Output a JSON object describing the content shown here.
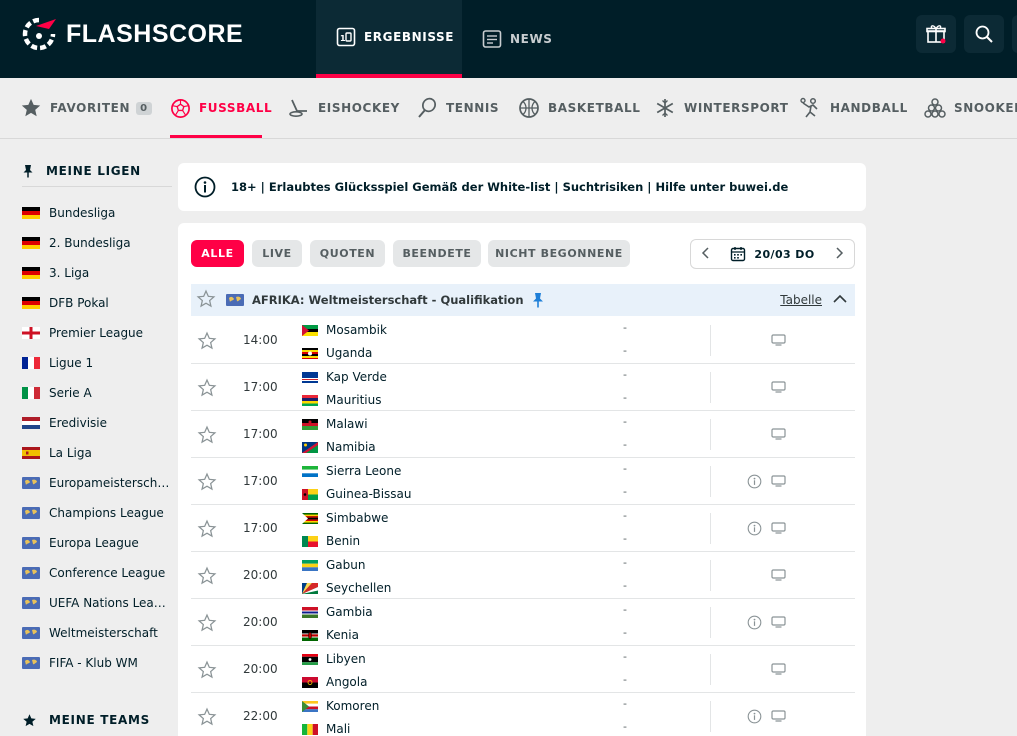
{
  "header": {
    "brand": "FLASHSCORE",
    "nav": [
      {
        "label": "ERGEBNISSE",
        "icon": "scoreboard-icon"
      },
      {
        "label": "NEWS",
        "icon": "newspaper-icon"
      }
    ],
    "actions": [
      "gift-icon",
      "search-icon"
    ]
  },
  "sports": {
    "favorites_label": "FAVORITEN",
    "favorites_count": "0",
    "items": [
      {
        "label": "FUSSBALL",
        "icon": "soccer-ball-icon",
        "active": true
      },
      {
        "label": "EISHOCKEY",
        "icon": "hockey-icon"
      },
      {
        "label": "TENNIS",
        "icon": "tennis-icon"
      },
      {
        "label": "BASKETBALL",
        "icon": "basketball-icon"
      },
      {
        "label": "WINTERSPORT",
        "icon": "snowflake-icon"
      },
      {
        "label": "HANDBALL",
        "icon": "handball-icon"
      },
      {
        "label": "SNOOKER",
        "icon": "snooker-icon"
      }
    ]
  },
  "sidebar": {
    "my_leagues_label": "MEINE LIGEN",
    "my_teams_label": "MEINE TEAMS",
    "leagues": [
      {
        "name": "Bundesliga",
        "flag": "de"
      },
      {
        "name": "2. Bundesliga",
        "flag": "de"
      },
      {
        "name": "3. Liga",
        "flag": "de"
      },
      {
        "name": "DFB Pokal",
        "flag": "de"
      },
      {
        "name": "Premier League",
        "flag": "en"
      },
      {
        "name": "Ligue 1",
        "flag": "fr"
      },
      {
        "name": "Serie A",
        "flag": "it"
      },
      {
        "name": "Eredivisie",
        "flag": "nl"
      },
      {
        "name": "La Liga",
        "flag": "es"
      },
      {
        "name": "Europameisterschaft",
        "flag": "world"
      },
      {
        "name": "Champions League",
        "flag": "world"
      },
      {
        "name": "Europa League",
        "flag": "world"
      },
      {
        "name": "Conference League",
        "flag": "world"
      },
      {
        "name": "UEFA Nations League",
        "flag": "world"
      },
      {
        "name": "Weltmeisterschaft",
        "flag": "world"
      },
      {
        "name": "FIFA - Klub WM",
        "flag": "world"
      }
    ]
  },
  "banner": {
    "text": "18+ | Erlaubtes Glücksspiel Gemäß der White-list | Suchtrisiken | Hilfe unter buwei.de"
  },
  "filters": [
    "ALLE",
    "LIVE",
    "QUOTEN",
    "BEENDETE",
    "NICHT BEGONNENE"
  ],
  "date": "20/03 DO",
  "league_header": {
    "name": "AFRIKA: Weltmeisterschaft - Qualifikation",
    "table_link": "Tabelle"
  },
  "matches": [
    {
      "time": "14:00",
      "home": "Mosambik",
      "away": "Uganda",
      "home_score": "-",
      "away_score": "-",
      "info": false
    },
    {
      "time": "17:00",
      "home": "Kap Verde",
      "away": "Mauritius",
      "home_score": "-",
      "away_score": "-",
      "info": false
    },
    {
      "time": "17:00",
      "home": "Malawi",
      "away": "Namibia",
      "home_score": "-",
      "away_score": "-",
      "info": false
    },
    {
      "time": "17:00",
      "home": "Sierra Leone",
      "away": "Guinea-Bissau",
      "home_score": "-",
      "away_score": "-",
      "info": true
    },
    {
      "time": "17:00",
      "home": "Simbabwe",
      "away": "Benin",
      "home_score": "-",
      "away_score": "-",
      "info": true
    },
    {
      "time": "20:00",
      "home": "Gabun",
      "away": "Seychellen",
      "home_score": "-",
      "away_score": "-",
      "info": false
    },
    {
      "time": "20:00",
      "home": "Gambia",
      "away": "Kenia",
      "home_score": "-",
      "away_score": "-",
      "info": true
    },
    {
      "time": "20:00",
      "home": "Libyen",
      "away": "Angola",
      "home_score": "-",
      "away_score": "-",
      "info": false
    },
    {
      "time": "22:00",
      "home": "Komoren",
      "away": "Mali",
      "home_score": "-",
      "away_score": "-",
      "info": true
    }
  ],
  "colors": {
    "brand_red": "#ff0046",
    "header_bg": "#001e28"
  }
}
